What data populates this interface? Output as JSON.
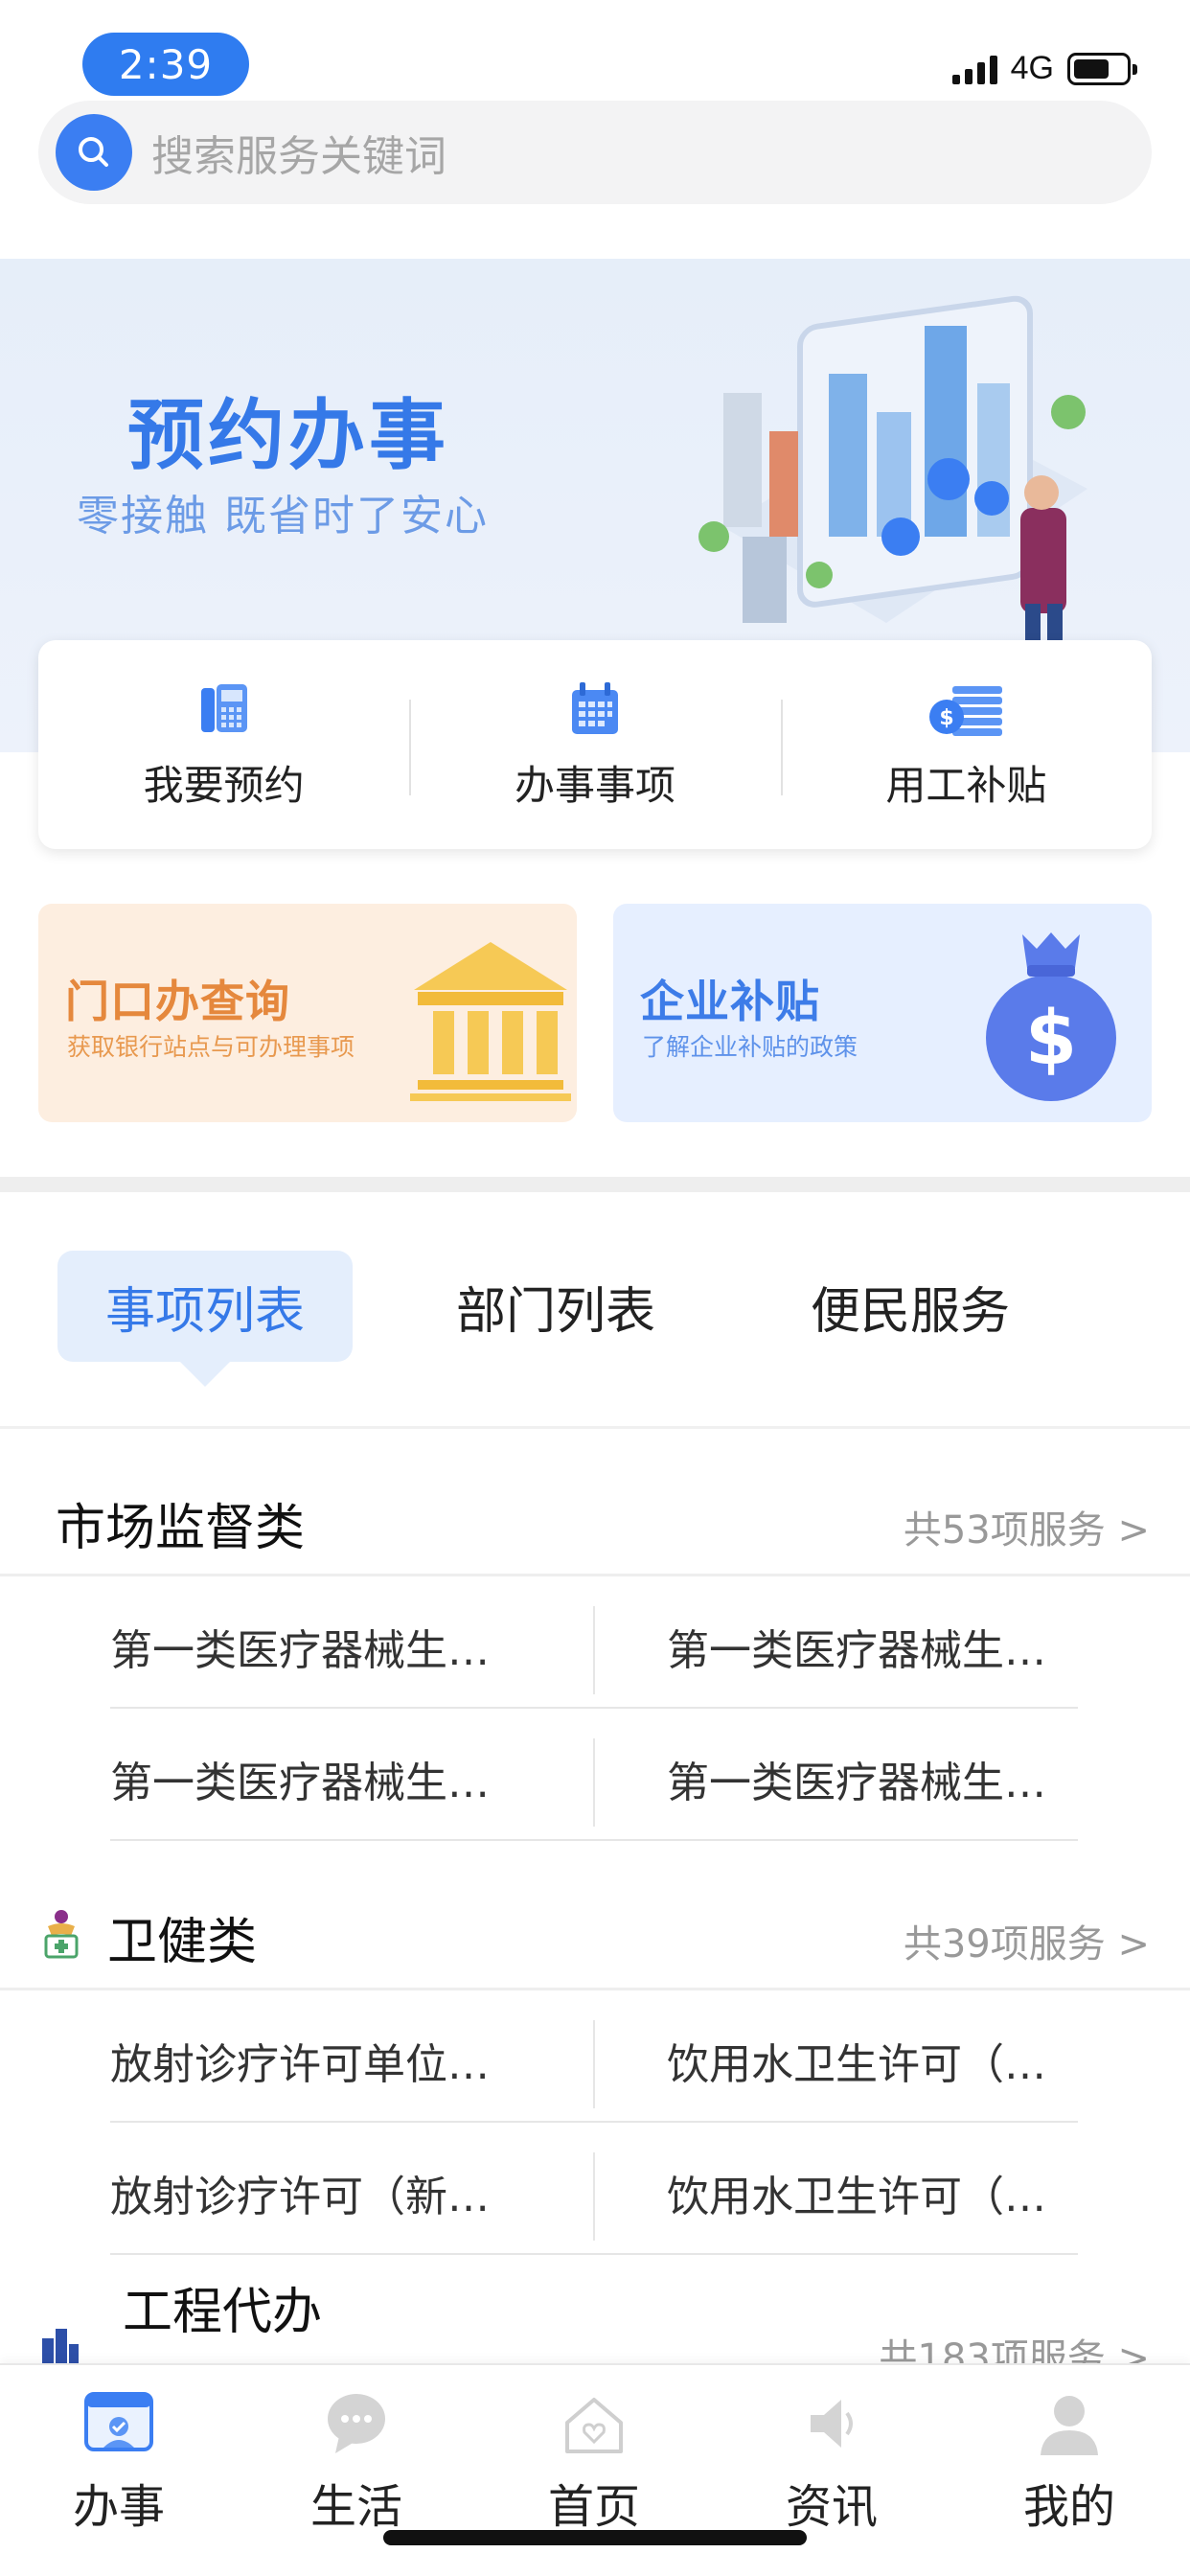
{
  "status_bar": {
    "time": "2:39",
    "network": "4G"
  },
  "search": {
    "placeholder": "搜索服务关键词"
  },
  "banner": {
    "title": "预约办事",
    "subtitle": "零接触  既省时了安心"
  },
  "quick_actions": [
    {
      "label": "我要预约",
      "icon": "phone-icon"
    },
    {
      "label": "办事事项",
      "icon": "calendar-icon"
    },
    {
      "label": "用工补贴",
      "icon": "coins-icon"
    }
  ],
  "promos": [
    {
      "title": "门口办查询",
      "desc": "获取银行站点与可办理事项",
      "icon": "bank-icon"
    },
    {
      "title": "企业补贴",
      "desc": "了解企业补贴的政策",
      "icon": "money-bag-icon"
    }
  ],
  "tabs": [
    {
      "label": "事项列表",
      "active": true
    },
    {
      "label": "部门列表",
      "active": false
    },
    {
      "label": "便民服务",
      "active": false
    }
  ],
  "categories": [
    {
      "title": "市场监督类",
      "count": "共53项服务 >",
      "items": [
        "第一类医疗器械生…",
        "第一类医疗器械生…",
        "第一类医疗器械生…",
        "第一类医疗器械生…"
      ]
    },
    {
      "title": "卫健类",
      "count": "共39项服务 >",
      "items": [
        "放射诊疗许可单位…",
        "饮用水卫生许可（…",
        "放射诊疗许可（新…",
        "饮用水卫生许可（…"
      ]
    },
    {
      "title": "工程代办",
      "count": "共183项服务 >"
    }
  ],
  "tabbar": [
    {
      "label": "办事",
      "icon": "service-card-icon",
      "active": true
    },
    {
      "label": "生活",
      "icon": "chat-bubble-icon",
      "active": false
    },
    {
      "label": "首页",
      "icon": "home-icon",
      "active": false
    },
    {
      "label": "资讯",
      "icon": "speaker-icon",
      "active": false
    },
    {
      "label": "我的",
      "icon": "user-icon",
      "active": false
    }
  ],
  "colors": {
    "accent": "#3579e8",
    "promo_orange": "#e5883d",
    "tab_active_bg": "#e4eefc",
    "muted": "#999999"
  }
}
